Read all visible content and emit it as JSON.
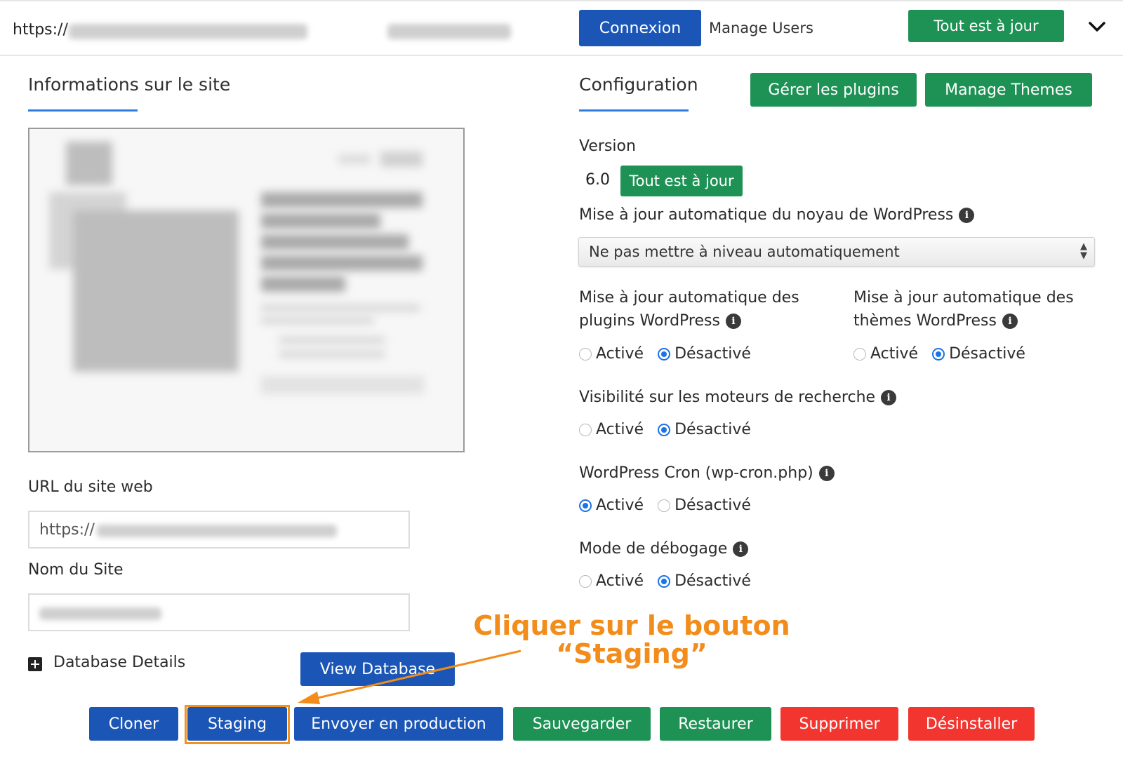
{
  "topbar": {
    "url_prefix": "https://",
    "login_button": "Connexion",
    "manage_users": "Manage Users",
    "status_button": "Tout est à jour"
  },
  "site_info": {
    "title": "Informations sur le site",
    "url_label": "URL du site web",
    "url_prefix": "https://",
    "name_label": "Nom du Site",
    "database_details": "Database Details",
    "view_database": "View Database"
  },
  "config": {
    "title": "Configuration",
    "manage_plugins": "Gérer les plugins",
    "manage_themes": "Manage Themes",
    "version_label": "Version",
    "version_value": "6.0",
    "version_status": "Tout est à jour",
    "core_update_label": "Mise à jour automatique du noyau de WordPress",
    "core_update_selected": "Ne pas mettre à niveau automatiquement",
    "plugins_update_line1": "Mise à jour automatique des",
    "plugins_update_line2": "plugins WordPress",
    "themes_update_line1": "Mise à jour automatique des",
    "themes_update_line2": "thèmes WordPress",
    "search_visibility": "Visibilité sur les moteurs de recherche",
    "cron": "WordPress Cron (wp-cron.php)",
    "debug": "Mode de débogage",
    "on_label": "Activé",
    "off_label": "Désactivé"
  },
  "annotation": {
    "line1": "Cliquer sur le bouton",
    "line2": "“Staging”"
  },
  "actions": {
    "clone": "Cloner",
    "staging": "Staging",
    "push": "Envoyer en production",
    "backup": "Sauvegarder",
    "restore": "Restaurer",
    "delete": "Supprimer",
    "uninstall": "Désinstaller"
  },
  "colors": {
    "blue": "#1b56b6",
    "green": "#1e9255",
    "red": "#f2362f",
    "annotation": "#f28c1b"
  }
}
